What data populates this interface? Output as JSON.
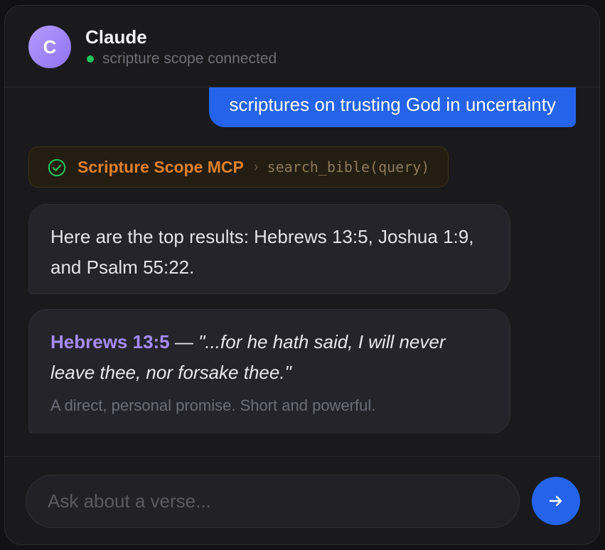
{
  "header": {
    "avatar_letter": "C",
    "title": "Claude",
    "status": "scripture scope connected",
    "status_color": "#22c55e"
  },
  "conversation": {
    "user_message": "scriptures on trusting God in uncertainty",
    "tool_call": {
      "status_icon": "check-circle-icon",
      "server": "Scripture Scope MCP",
      "separator": "›",
      "call": "search_bible(query)"
    },
    "assistant_reply": "Here are the top results: Hebrews 13:5, Joshua 1:9, and Psalm 55:22.",
    "verse_card": {
      "reference": "Hebrews 13:5",
      "dash": " — ",
      "quote": "\"...for he hath said, I will never leave thee, nor forsake thee.\"",
      "note": "A direct, personal promise. Short and powerful."
    }
  },
  "composer": {
    "placeholder": "Ask about a verse...",
    "value": "",
    "send_icon": "arrow-right-icon"
  },
  "colors": {
    "accent_blue": "#2563eb",
    "avatar_purple": "#a78bfa",
    "tool_orange": "#e0812c",
    "background": "#1a1a1c"
  }
}
